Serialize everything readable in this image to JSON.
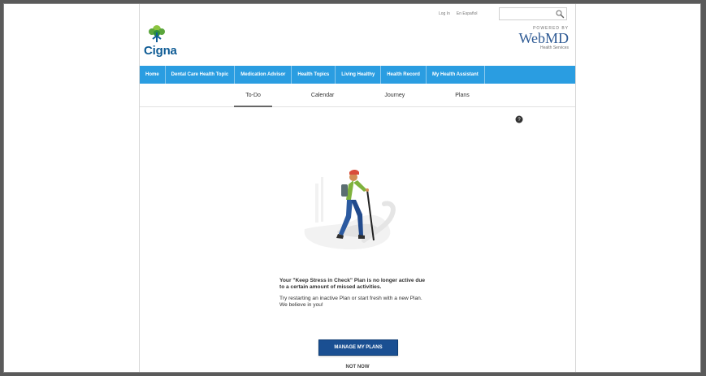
{
  "header": {
    "utility_links": [
      "Log In",
      "En Español"
    ],
    "search_placeholder": "",
    "brand_logo_text": "Cigna",
    "powered_by": "POWERED BY",
    "webmd_brand": "WebMD",
    "webmd_subtitle": "Health Services"
  },
  "nav": {
    "items": [
      "Home",
      "Dental Care Health Topic",
      "Medication Advisor",
      "Health Topics",
      "Living Healthy",
      "Health Record",
      "My Health Assistant"
    ]
  },
  "tabs": {
    "items": [
      "To-Do",
      "Calendar",
      "Journey",
      "Plans"
    ],
    "active": "To-Do"
  },
  "message": {
    "bold": "Your \"Keep Stress in Check\" Plan is no longer active due to a certain amount of missed activities.",
    "regular": "Try restarting an inactive Plan or start fresh with a new Plan. We believe in you!"
  },
  "actions": {
    "manage_label": "MANAGE MY PLANS",
    "not_now_label": "NOT NOW"
  },
  "colors": {
    "nav_blue": "#2a9de1",
    "button_blue": "#1a4f92",
    "logo_blue": "#0f5c95"
  }
}
